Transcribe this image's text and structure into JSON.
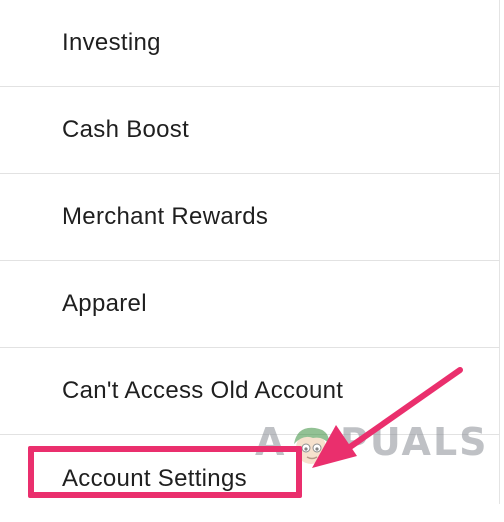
{
  "menu": {
    "items": [
      {
        "label": "Investing"
      },
      {
        "label": "Cash Boost"
      },
      {
        "label": "Merchant Rewards"
      },
      {
        "label": "Apparel"
      },
      {
        "label": "Can't Access Old Account"
      },
      {
        "label": "Account Settings"
      }
    ]
  },
  "annotation": {
    "highlight_color": "#ea2f6d",
    "highlighted_item": "Account Settings"
  },
  "watermark": {
    "first_letter": "A",
    "rest": "PUALS"
  },
  "colors": {
    "text": "#1f1f1f",
    "divider": "#e2e2e2",
    "background": "#ffffff"
  }
}
